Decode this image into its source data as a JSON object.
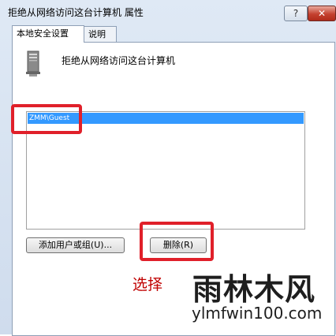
{
  "window": {
    "title": "拒绝从网络访问这台计算机 属性",
    "help_label": "?",
    "close_label": "✕"
  },
  "tabs": [
    {
      "label": "本地安全设置",
      "active": true
    },
    {
      "label": "说明",
      "active": false
    }
  ],
  "panel": {
    "heading": "拒绝从网络访问这台计算机",
    "icon": "computer-tower-icon",
    "list_items": [
      "ZMM\\Guest"
    ],
    "add_button_label": "添加用户或组(U)...",
    "remove_button_label": "删除(R)"
  },
  "annotation": {
    "caption": "选择",
    "highlight_color": "#e0202a"
  },
  "watermark": {
    "logo": "雨林木风",
    "url": "ylmfwin100.com"
  }
}
